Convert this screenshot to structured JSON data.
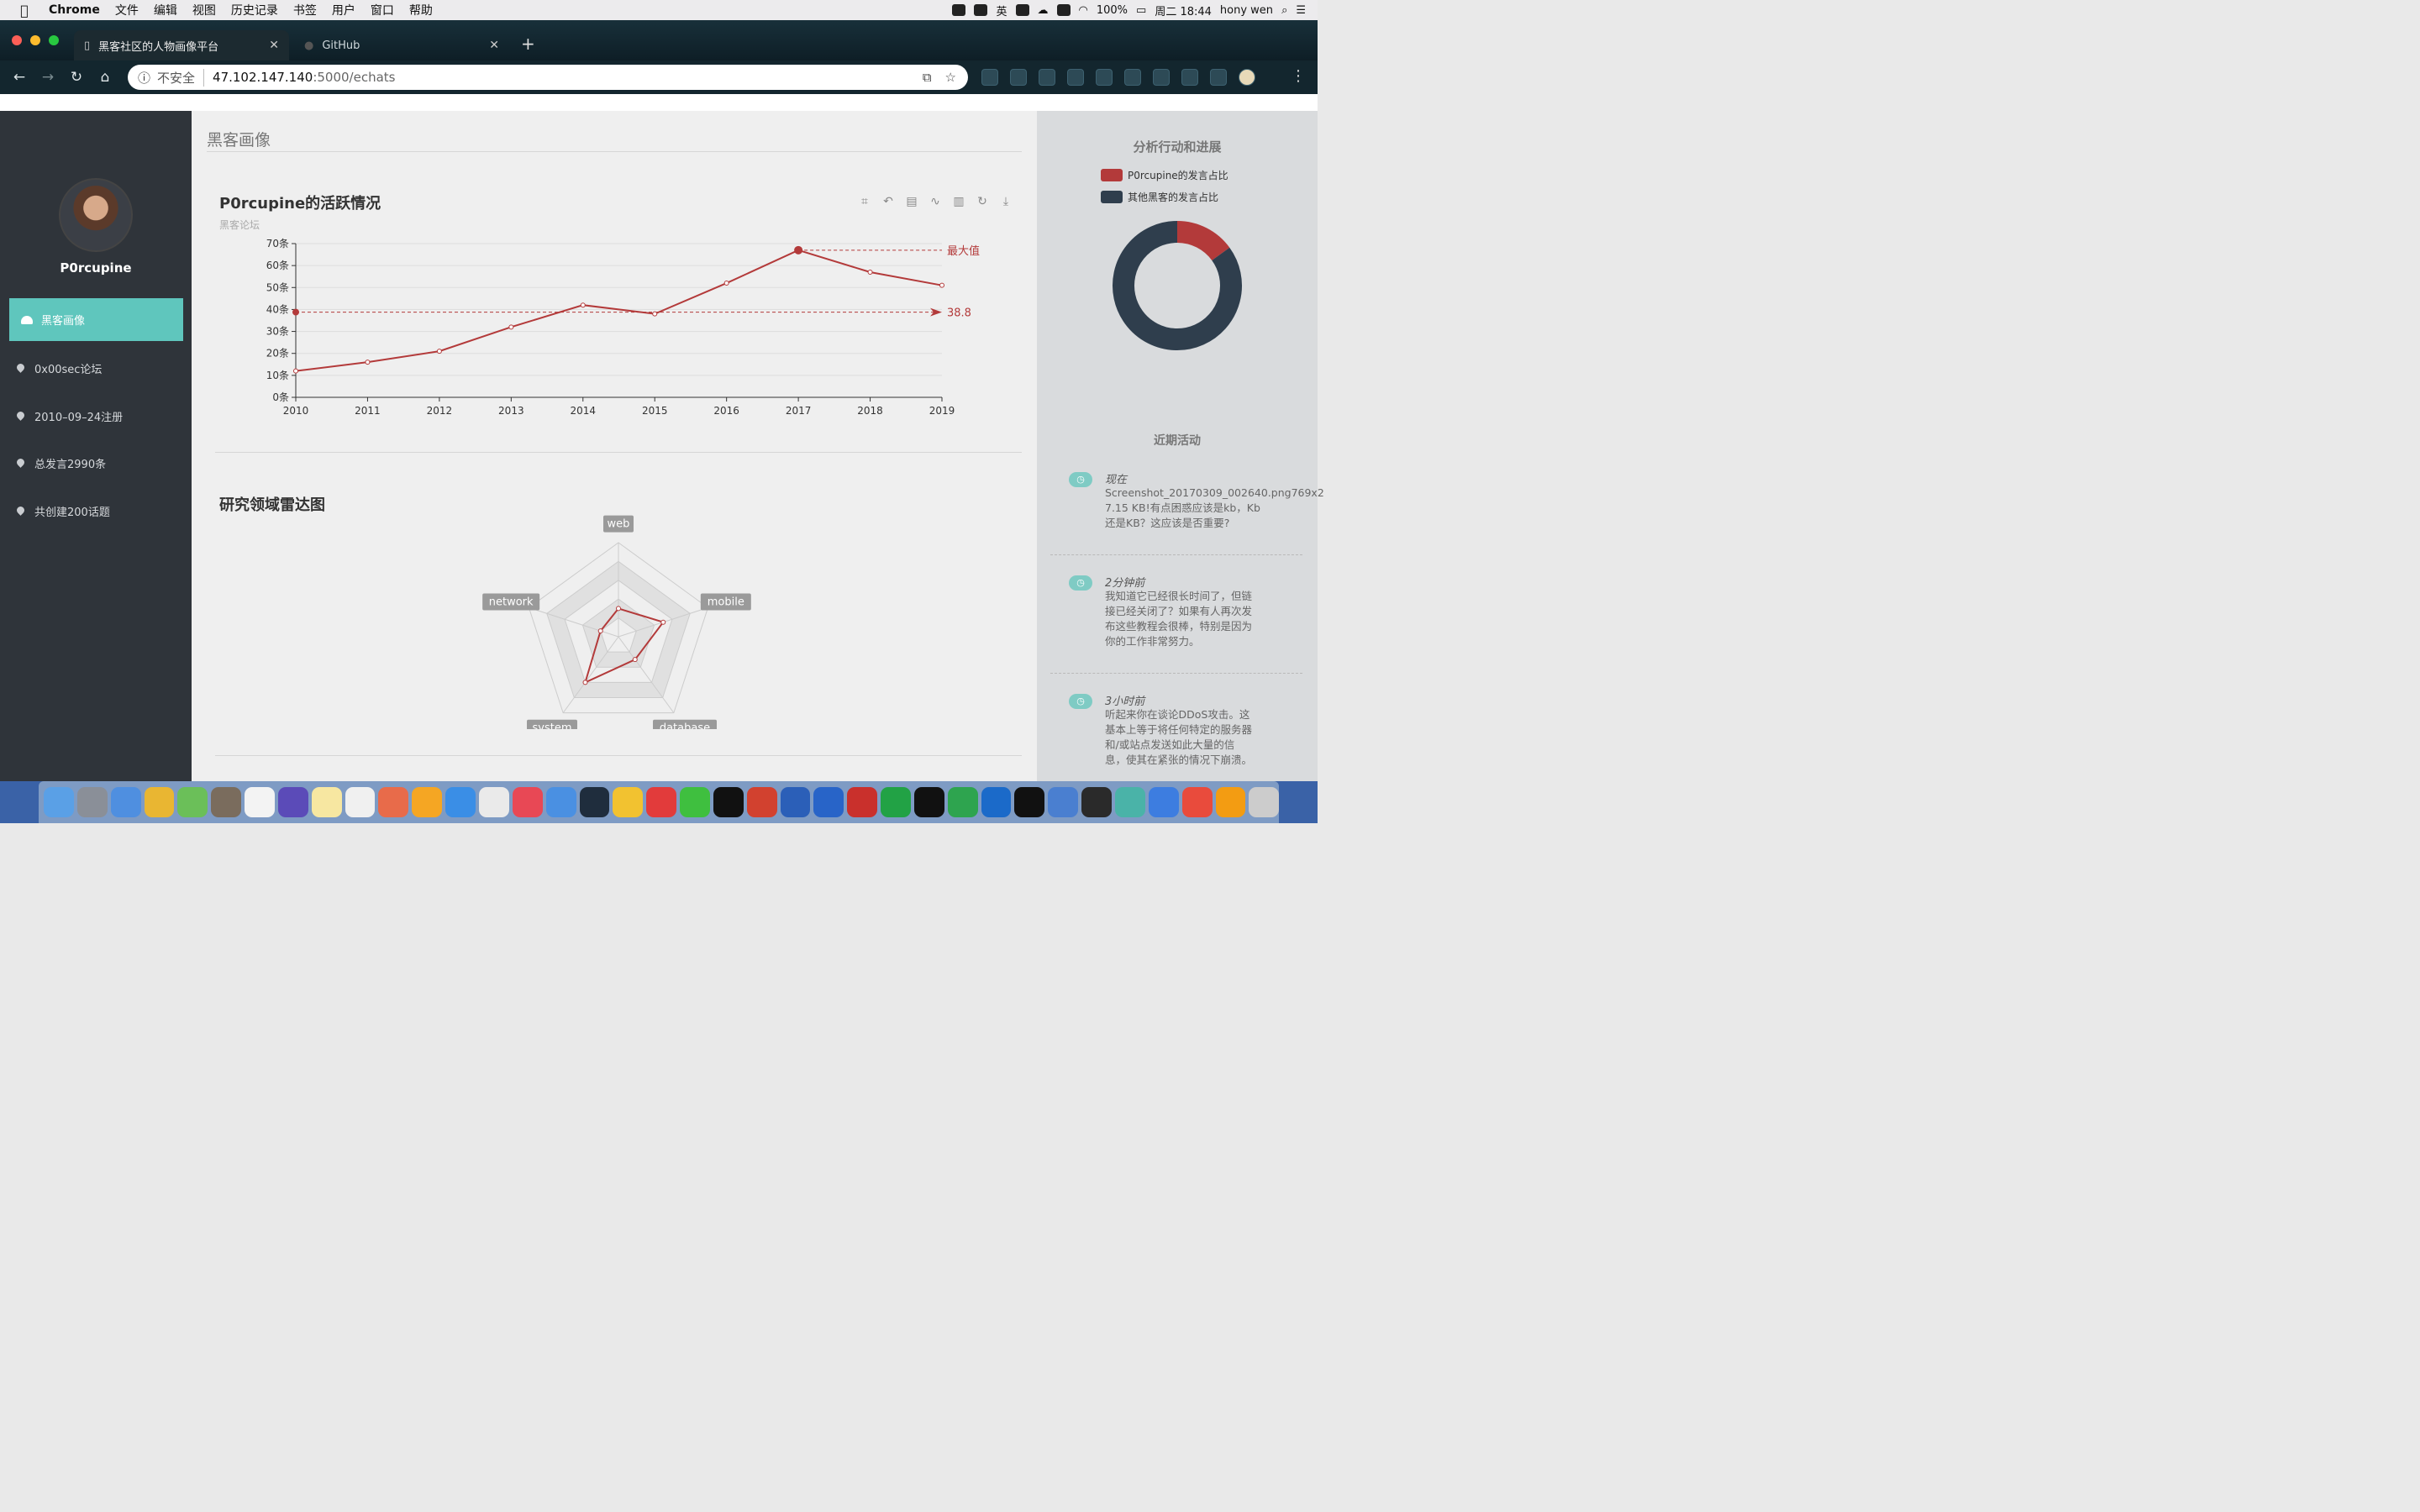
{
  "menubar": {
    "app": "Chrome",
    "items": [
      "文件",
      "编辑",
      "视图",
      "历史记录",
      "书签",
      "用户",
      "窗口",
      "帮助"
    ],
    "battery": "100%",
    "clock": "周二 18:44",
    "user": "hony wen",
    "input_method": "英"
  },
  "browser": {
    "tabs": [
      {
        "title": "黑客社区的人物画像平台",
        "active": true
      },
      {
        "title": "GitHub",
        "active": false
      }
    ],
    "address": {
      "security": "不安全",
      "host": "47.102.147.140",
      "path": ":5000/echats"
    }
  },
  "sidebar": {
    "username": "P0rcupine",
    "active_item": "黑客画像",
    "items": [
      "0x00sec论坛",
      "2010–09–24注册",
      "总发言2990条",
      "共创建200话题"
    ]
  },
  "main": {
    "page_title": "黑客画像",
    "radar_title": "研究领域雷达图"
  },
  "chart_data": [
    {
      "type": "line",
      "title": "P0rcupine的活跃情况",
      "subtitle": "黑客论坛",
      "categories": [
        "2010",
        "2011",
        "2012",
        "2013",
        "2014",
        "2015",
        "2016",
        "2017",
        "2018",
        "2019"
      ],
      "values": [
        12,
        16,
        21,
        32,
        42,
        38,
        52,
        67,
        57,
        51
      ],
      "yunit": "条",
      "ylim": [
        0,
        70
      ],
      "yticks": [
        0,
        10,
        20,
        30,
        40,
        50,
        60,
        70
      ],
      "markline_average": 38.8,
      "markpoint_max_label": "最大值",
      "color": "#b33a3a"
    },
    {
      "type": "radar",
      "indicators": [
        "web",
        "mobile",
        "database",
        "system",
        "network"
      ],
      "values": [
        0.3,
        0.5,
        0.3,
        0.6,
        0.2
      ],
      "color": "#b33a3a"
    },
    {
      "type": "pie",
      "title": "分析行动和进展",
      "legend": [
        {
          "name": "P0rcupine的发言占比",
          "value": 15,
          "color": "#b33a3a"
        },
        {
          "name": "其他黑客的发言占比",
          "value": 85,
          "color": "#2f3e4d"
        }
      ]
    }
  ],
  "activity": {
    "title": "近期活动",
    "items": [
      {
        "when": "现在",
        "text": "Screenshot_20170309_002640.png769x2\n7.15 KB!有点困惑应该是kb，Kb\n还是KB？这应该是否重要?"
      },
      {
        "when": "2分钟前",
        "text": "我知道它已经很长时间了，但链\n接已经关闭了？如果有人再次发\n布这些教程会很棒，特别是因为\n你的工作非常努力。"
      },
      {
        "when": "3小时前",
        "text": "听起来你在谈论DDoS攻击。这\n基本上等于将任何特定的服务器\n和/或站点发送如此大量的信\n息，使其在紧张的情况下崩溃。"
      }
    ]
  }
}
